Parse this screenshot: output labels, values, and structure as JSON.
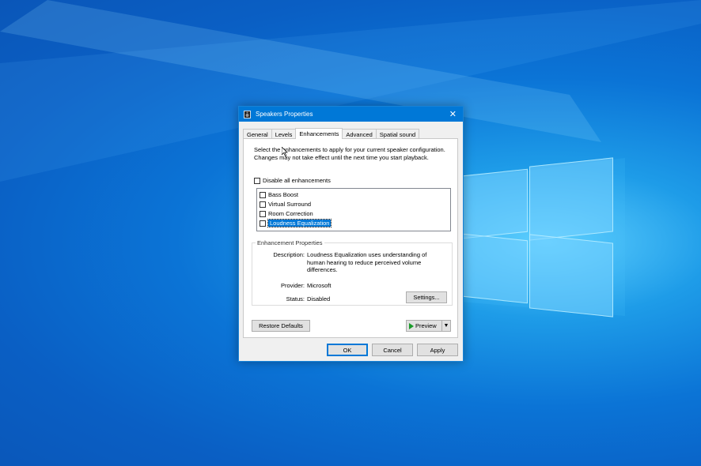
{
  "colors": {
    "accent": "#0078d7",
    "desktop": "#0a6ad0"
  },
  "dialog": {
    "title": "Speakers Properties",
    "close_icon": "close-icon",
    "tabs": [
      "General",
      "Levels",
      "Enhancements",
      "Advanced",
      "Spatial sound"
    ],
    "active_tab": "Enhancements",
    "intro_text": "Select the enhancements to apply for your current speaker configuration. Changes may not take effect until the next time you start playback.",
    "disable_all_label": "Disable all enhancements",
    "enhancements": [
      {
        "label": "Bass Boost",
        "checked": false
      },
      {
        "label": "Virtual Surround",
        "checked": false
      },
      {
        "label": "Room Correction",
        "checked": false
      },
      {
        "label": "Loudness Equalization",
        "checked": false
      }
    ],
    "properties": {
      "group_title": "Enhancement Properties",
      "description_label": "Description:",
      "description_value": "Loudness Equalization uses understanding of human hearing to reduce perceived volume differences.",
      "provider_label": "Provider:",
      "provider_value": "Microsoft",
      "status_label": "Status:",
      "status_value": "Disabled",
      "settings_button": "Settings..."
    },
    "restore_defaults": "Restore Defaults",
    "preview": "Preview",
    "buttons": {
      "ok": "OK",
      "cancel": "Cancel",
      "apply": "Apply"
    }
  }
}
